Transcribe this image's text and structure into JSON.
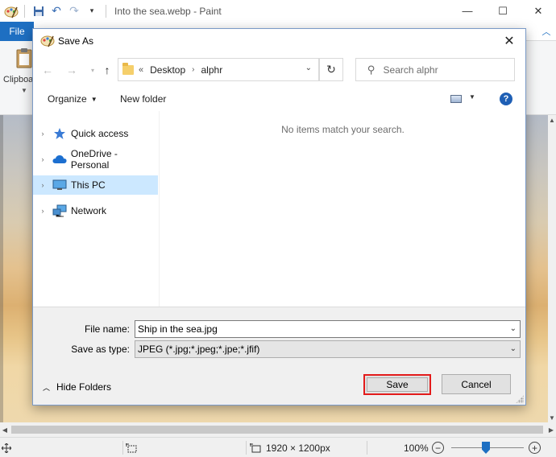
{
  "paint": {
    "title": "Into the sea.webp - Paint",
    "file_tab": "File",
    "clipboard_label": "Clipboard",
    "status": {
      "dimensions": "1920 × 1200px",
      "zoom": "100%"
    }
  },
  "dialog": {
    "title": "Save As",
    "address": {
      "chevron": "«",
      "segments": [
        "Desktop",
        "alphr"
      ]
    },
    "search_placeholder": "Search alphr",
    "toolbar": {
      "organize": "Organize",
      "new_folder": "New folder"
    },
    "nav_items": [
      {
        "label": "Quick access",
        "icon": "star-icon"
      },
      {
        "label": "OneDrive - Personal",
        "icon": "cloud-icon"
      },
      {
        "label": "This PC",
        "icon": "monitor-icon"
      },
      {
        "label": "Network",
        "icon": "network-icon"
      }
    ],
    "empty_message": "No items match your search.",
    "file_name_label": "File name:",
    "file_name_value": "Ship in the sea.jpg",
    "save_as_type_label": "Save as type:",
    "save_as_type_value": "JPEG (*.jpg;*.jpeg;*.jpe;*.jfif)",
    "hide_folders": "Hide Folders",
    "save": "Save",
    "cancel": "Cancel"
  },
  "colors": {
    "accent": "#1e6fc2",
    "selection": "#cce8ff",
    "highlight": "#e31b1b"
  }
}
